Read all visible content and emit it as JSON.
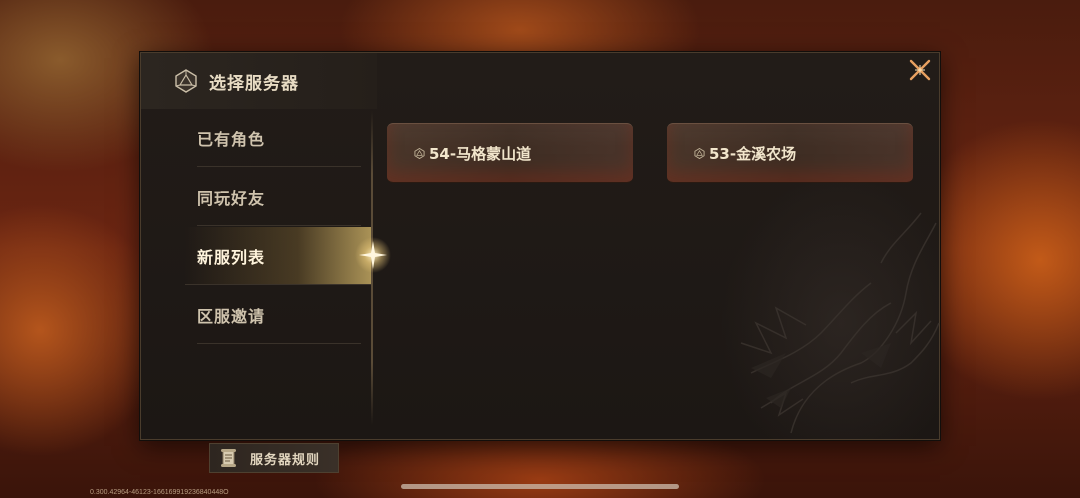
{
  "dialog": {
    "title": "选择服务器",
    "title_icon": "d20-dice-icon",
    "close_icon": "close-x-icon"
  },
  "sidebar": {
    "items": [
      {
        "label": "已有角色",
        "active": false
      },
      {
        "label": "同玩好友",
        "active": false
      },
      {
        "label": "新服列表",
        "active": true
      },
      {
        "label": "区服邀请",
        "active": false
      }
    ],
    "rules_button": {
      "label": "服务器规则",
      "icon": "scroll-icon"
    }
  },
  "servers": [
    {
      "name": "54-马格蒙山道",
      "icon": "server-dice-icon"
    },
    {
      "name": "53-金溪农场",
      "icon": "server-dice-icon"
    }
  ],
  "footer": {
    "version": "0.300.42964-46123-166169919236840448O"
  },
  "colors": {
    "accent_gold": "#e8c77a",
    "text_light": "#f2e6cc",
    "panel_bg": "#1c1714"
  }
}
